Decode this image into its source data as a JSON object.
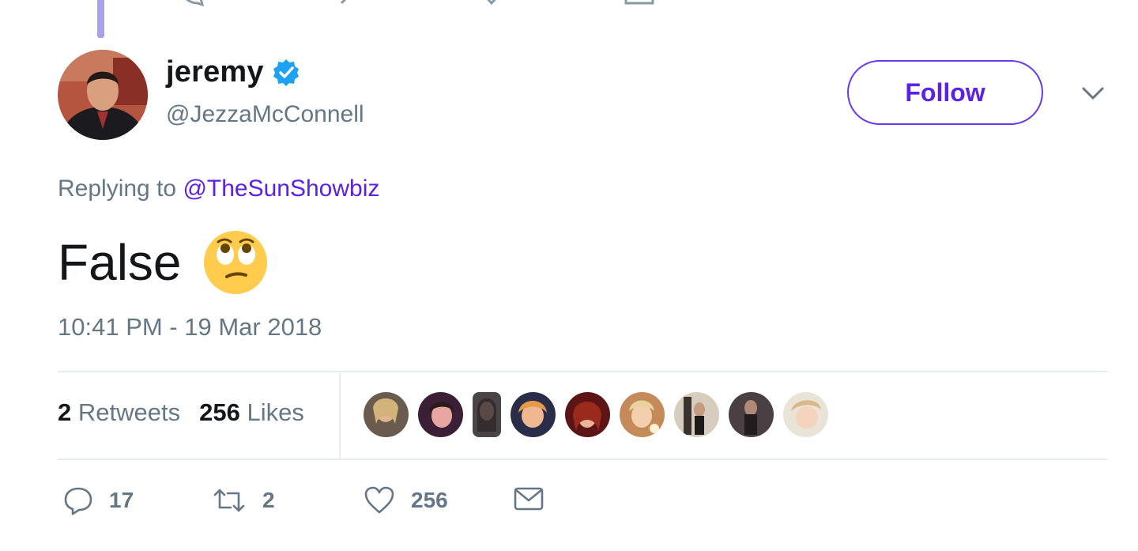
{
  "tweet": {
    "user": {
      "name": "jeremy",
      "handle": "@JezzaMcConnell",
      "verified": true,
      "avatar_icon": "profile-photo"
    },
    "follow_label": "Follow",
    "replying_prefix": "Replying to",
    "replying_to": "@TheSunShowbiz",
    "text": "False",
    "emoji": "face-with-rolling-eyes",
    "timestamp": "10:41 PM - 19 Mar 2018",
    "stats": {
      "retweets_count": "2",
      "retweets_label": "Retweets",
      "likes_count": "256",
      "likes_label": "Likes"
    },
    "likers": [
      "liker-1",
      "liker-2",
      "liker-3",
      "liker-4",
      "liker-5",
      "liker-6",
      "liker-7",
      "liker-8",
      "liker-9"
    ],
    "actions": {
      "replies": "17",
      "retweets": "2",
      "likes": "256"
    }
  },
  "colors": {
    "accent": "#5b21e8",
    "muted": "#657786",
    "verified": "#1da1f2",
    "divider": "#e6ecf0",
    "thread_line": "#a9a0f0"
  }
}
